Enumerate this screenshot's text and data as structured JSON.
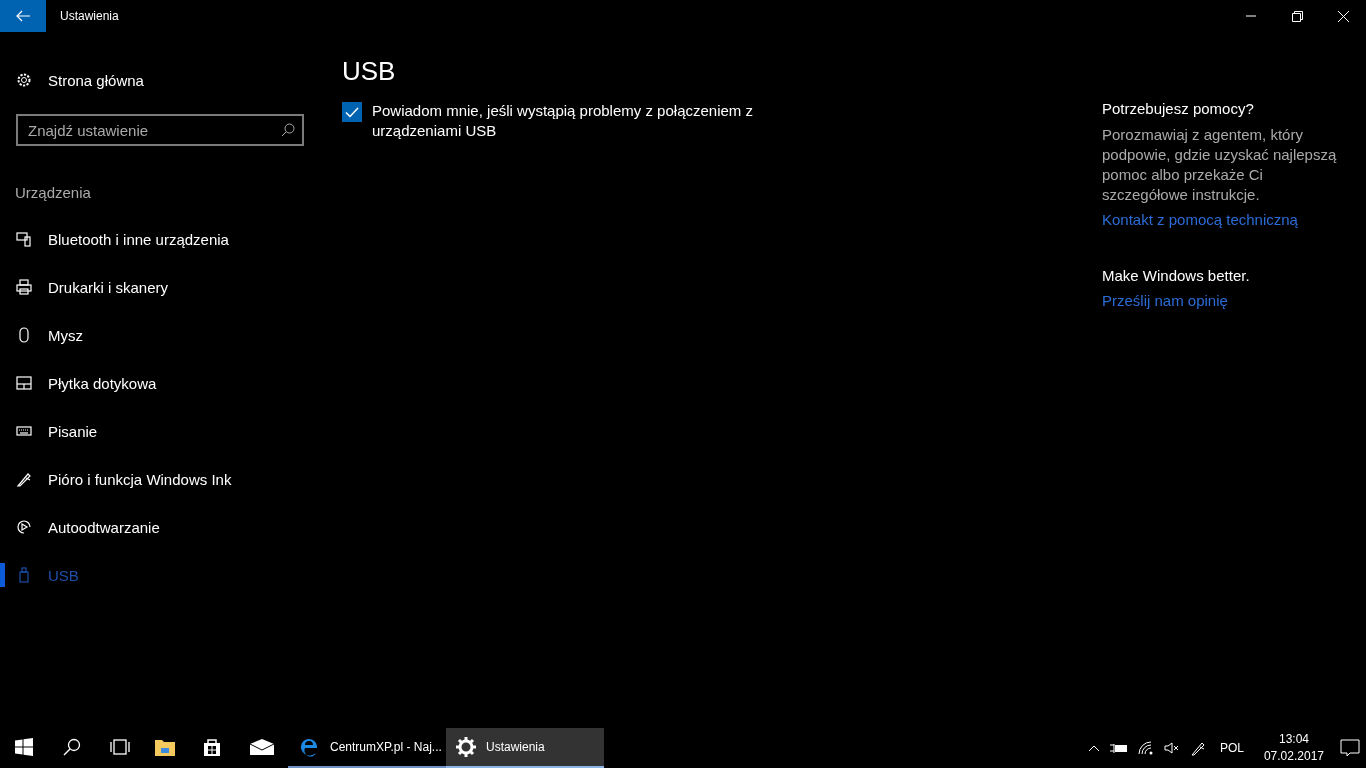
{
  "window": {
    "title": "Ustawienia"
  },
  "sidebar": {
    "home": "Strona główna",
    "search": {
      "placeholder": "Znajdź ustawienie"
    },
    "section": "Urządzenia",
    "items": [
      {
        "label": "Bluetooth i inne urządzenia",
        "kind": "bluetooth",
        "selected": false
      },
      {
        "label": "Drukarki i skanery",
        "kind": "printer",
        "selected": false
      },
      {
        "label": "Mysz",
        "kind": "mouse",
        "selected": false
      },
      {
        "label": "Płytka dotykowa",
        "kind": "touchpad",
        "selected": false
      },
      {
        "label": "Pisanie",
        "kind": "keyboard",
        "selected": false
      },
      {
        "label": "Pióro i funkcja Windows Ink",
        "kind": "pen",
        "selected": false
      },
      {
        "label": "Autoodtwarzanie",
        "kind": "autoplay",
        "selected": false
      },
      {
        "label": "USB",
        "kind": "usb",
        "selected": true
      }
    ]
  },
  "content": {
    "title": "USB",
    "option": {
      "label": "Powiadom mnie, jeśli wystąpią problemy z połączeniem z urządzeniami USB",
      "checked": true
    }
  },
  "help": [
    {
      "heading": "Potrzebujesz pomocy?",
      "text": "Porozmawiaj z agentem, który podpowie, gdzie uzyskać najlepszą pomoc albo przekaże Ci szczegółowe instrukcje.",
      "link": "Kontakt z pomocą techniczną"
    },
    {
      "heading": "Make Windows better.",
      "link": "Prześlij nam opinię"
    }
  ],
  "taskbar": {
    "apps": [
      {
        "kind": "explorer",
        "selected": false,
        "open": false
      },
      {
        "kind": "store",
        "selected": false,
        "open": false
      },
      {
        "kind": "mail",
        "selected": false,
        "open": false
      },
      {
        "kind": "edge",
        "label": "CentrumXP.pl - Naj...",
        "selected": false,
        "open": true
      },
      {
        "kind": "settings",
        "label": "Ustawienia",
        "selected": true,
        "open": true
      }
    ],
    "language": "POL",
    "time": "13:04",
    "date": "07.02.2017"
  }
}
